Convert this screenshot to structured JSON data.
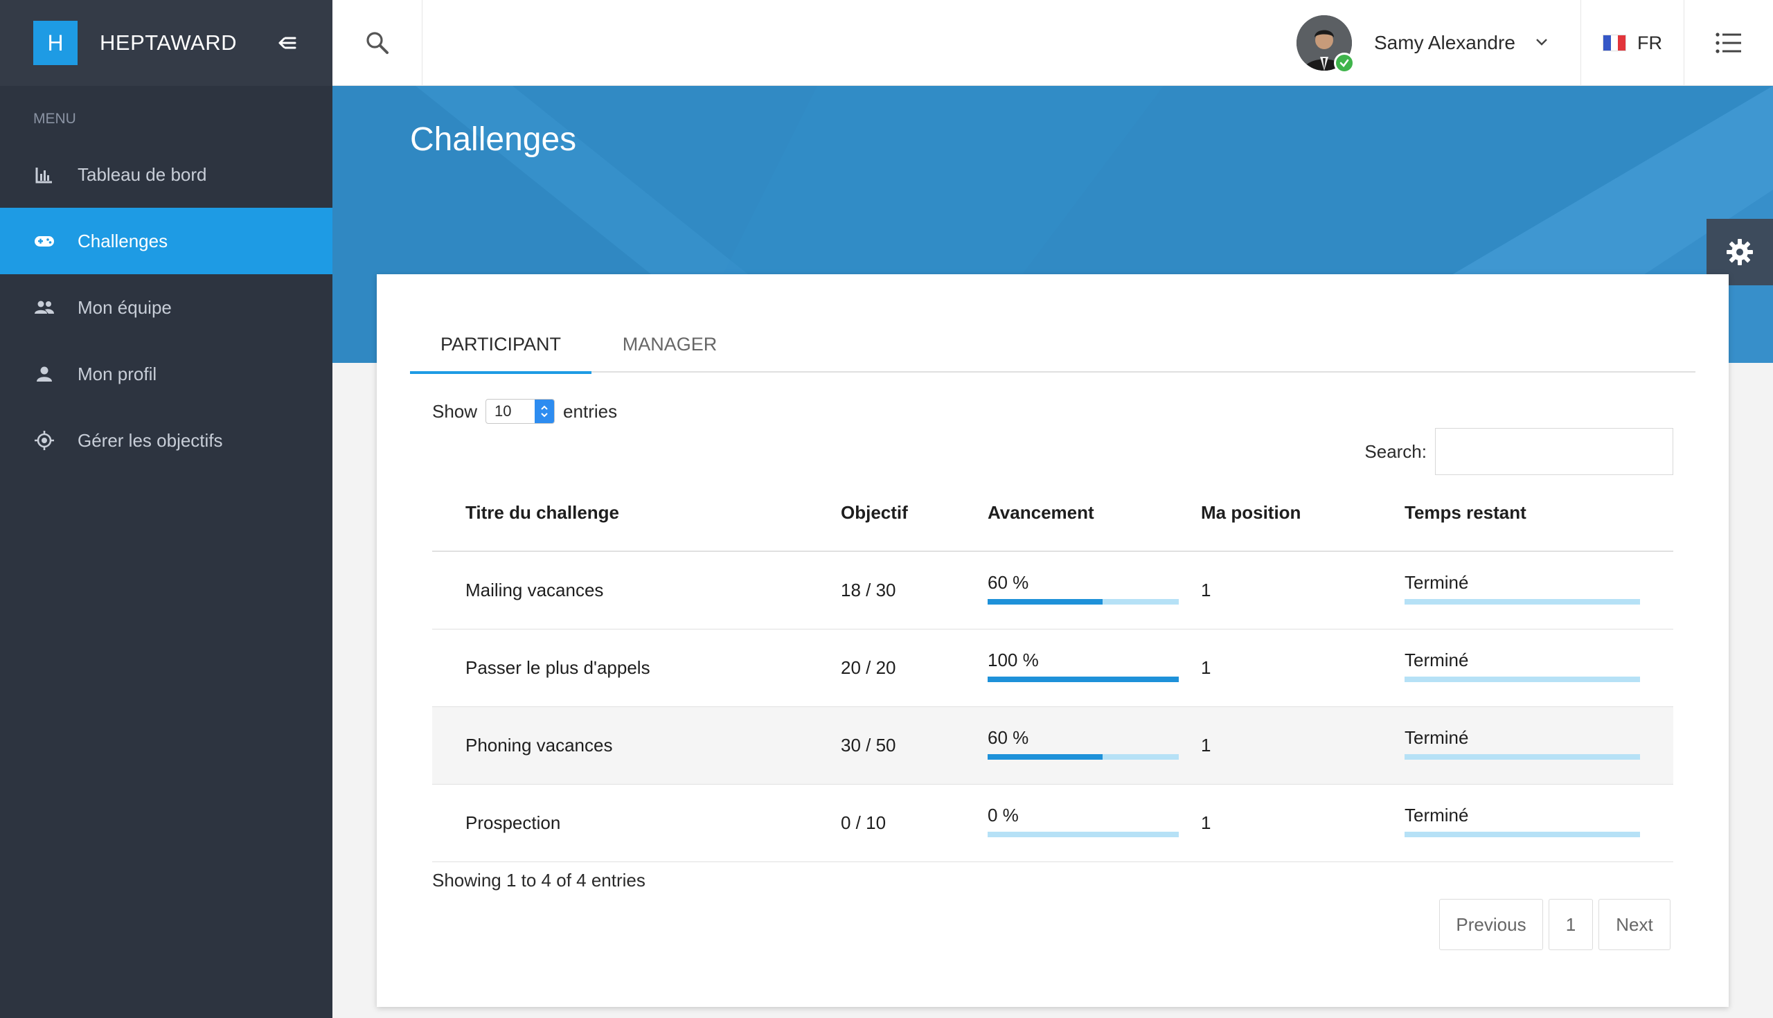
{
  "brand": {
    "logo_letter": "H",
    "name": "HEPTAWARD"
  },
  "sidebar": {
    "menu_label": "MENU",
    "items": [
      {
        "label": "Tableau de bord",
        "icon": "bar-chart-icon",
        "active": false
      },
      {
        "label": "Challenges",
        "icon": "gamepad-icon",
        "active": true
      },
      {
        "label": "Mon équipe",
        "icon": "group-icon",
        "active": false
      },
      {
        "label": "Mon profil",
        "icon": "person-icon",
        "active": false
      },
      {
        "label": "Gérer les objectifs",
        "icon": "target-icon",
        "active": false
      }
    ]
  },
  "topbar": {
    "user_name": "Samy Alexandre",
    "language": "FR"
  },
  "page": {
    "title": "Challenges"
  },
  "tabs": [
    {
      "label": "PARTICIPANT",
      "active": true
    },
    {
      "label": "MANAGER",
      "active": false
    }
  ],
  "table_controls": {
    "show_label": "Show",
    "entries_label": "entries",
    "page_length": "10",
    "search_label": "Search:",
    "search_value": ""
  },
  "table": {
    "columns": [
      "Titre du challenge",
      "Objectif",
      "Avancement",
      "Ma position",
      "Temps restant"
    ],
    "rows": [
      {
        "title": "Mailing vacances",
        "objective": "18 / 30",
        "progress_label": "60 %",
        "progress": 60,
        "position": "1",
        "remaining": "Terminé"
      },
      {
        "title": "Passer le plus d'appels",
        "objective": "20 / 20",
        "progress_label": "100 %",
        "progress": 100,
        "position": "1",
        "remaining": "Terminé"
      },
      {
        "title": "Phoning vacances",
        "objective": "30 / 50",
        "progress_label": "60 %",
        "progress": 60,
        "position": "1",
        "remaining": "Terminé"
      },
      {
        "title": "Prospection",
        "objective": "0 / 10",
        "progress_label": "0 %",
        "progress": 0,
        "position": "1",
        "remaining": "Terminé"
      }
    ]
  },
  "footer": {
    "info": "Showing 1 to 4 of 4 entries",
    "previous": "Previous",
    "page": "1",
    "next": "Next"
  },
  "colors": {
    "accent": "#1e9be4",
    "sidebar_bg": "#2d3440",
    "banner_bg": "#318ac4",
    "online": "#3fb44b"
  }
}
